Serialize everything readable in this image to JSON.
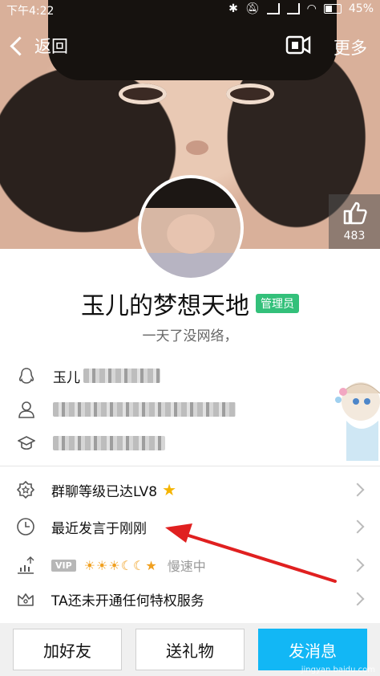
{
  "status_bar": {
    "time": "下午4:22",
    "battery": "45%"
  },
  "nav": {
    "back_label": "返回",
    "more_label": "更多"
  },
  "like": {
    "count": "483"
  },
  "profile": {
    "name": "玉儿的梦想天地",
    "role_badge": "管理员",
    "signature": "一天了没网络，"
  },
  "info": {
    "qq_name_prefix": "玉儿"
  },
  "rows": {
    "group_level": "群聊等级已达LV8",
    "last_speak": "最近发言于刚刚",
    "vip_label": "VIP",
    "vip_speed": "慢速中",
    "privilege": "TA还未开通任何特权服务"
  },
  "buttons": {
    "add_friend": "加好友",
    "send_gift": "送礼物",
    "send_message": "发消息"
  },
  "watermark": "jingyan.baidu.com",
  "colors": {
    "accent": "#12b7f5",
    "badge": "#33c07a",
    "arrow": "#e02020"
  },
  "icons": [
    "qq-penguin-icon",
    "person-icon",
    "graduation-cap-icon",
    "gear-badge-icon",
    "clock-icon",
    "chart-icon",
    "crown-icon",
    "thumb-up-icon",
    "video-call-icon",
    "chevron-left-icon"
  ]
}
